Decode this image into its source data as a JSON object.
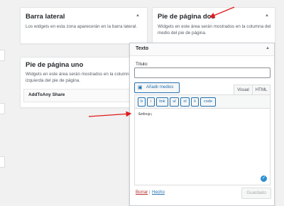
{
  "areas": {
    "barra_lateral": {
      "title": "Barra lateral",
      "desc": "Los widgets en esta zona aparecerán en la barra lateral."
    },
    "pie_dos": {
      "title": "Pie de página dos",
      "desc": "Widgets en este área serán mostrados en la columna del medio del pie de página."
    },
    "pie_uno": {
      "title": "Pie de página uno",
      "desc": "Widgets en este área serán mostrados en la columna izquierda del pie de página.",
      "widget": "AddToAny Share"
    }
  },
  "texto_widget": {
    "title": "Texto",
    "titulo_label": "Título:",
    "titulo_value": "",
    "media_button": "Añadir medios",
    "tabs": [
      "Visual",
      "HTML"
    ],
    "quicktags": [
      "b",
      "i",
      "link",
      "ul",
      "ol",
      "li",
      "code"
    ],
    "content": "&nbsp;",
    "delete_link": "Borrar",
    "done_link": "Hecho",
    "save_button": "Guardado"
  },
  "icons": {
    "toggle": "triangle-up-icon",
    "media": "media-icon",
    "grip": "check-circle-icon"
  },
  "colors": {
    "link": "#b32d2e",
    "done": "#2271b1",
    "annotation_arrow": "#e0191b"
  }
}
